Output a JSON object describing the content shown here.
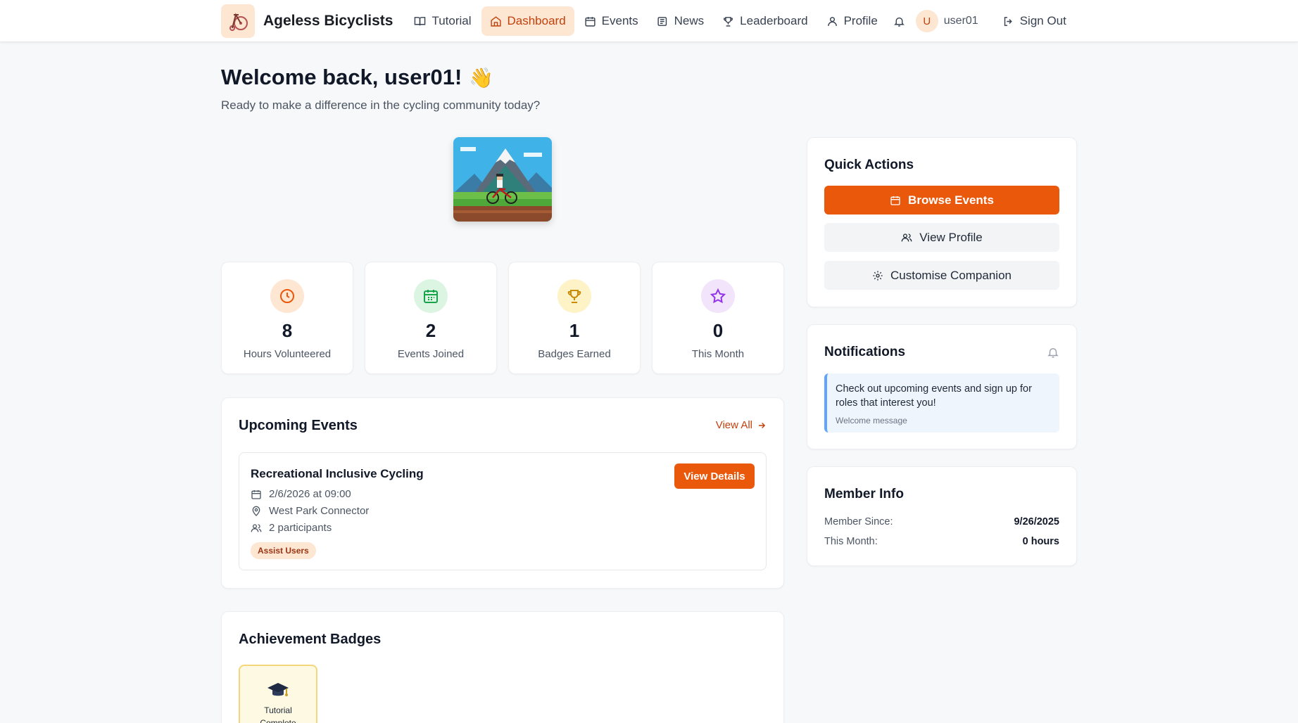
{
  "nav": {
    "brand": "Ageless Bicyclists",
    "items": [
      {
        "label": "Tutorial",
        "icon": "book-icon"
      },
      {
        "label": "Dashboard",
        "icon": "home-icon",
        "active": true
      },
      {
        "label": "Events",
        "icon": "calendar-icon"
      },
      {
        "label": "News",
        "icon": "newspaper-icon"
      },
      {
        "label": "Leaderboard",
        "icon": "trophy-icon"
      },
      {
        "label": "Profile",
        "icon": "user-icon"
      }
    ],
    "avatar_initial": "U",
    "username": "user01",
    "sign_out": "Sign Out"
  },
  "header": {
    "welcome": "Welcome back, user01!",
    "wave": "👋",
    "subtitle": "Ready to make a difference in the cycling community today?"
  },
  "stats": [
    {
      "value": "8",
      "label": "Hours Volunteered",
      "icon": "clock-icon",
      "color": "#ea580c",
      "bg": "#fde6d2"
    },
    {
      "value": "2",
      "label": "Events Joined",
      "icon": "calendar-icon",
      "color": "#16a34a",
      "bg": "#dcf5e3"
    },
    {
      "value": "1",
      "label": "Badges Earned",
      "icon": "trophy-icon",
      "color": "#ca8a04",
      "bg": "#fdf3c7"
    },
    {
      "value": "0",
      "label": "This Month",
      "icon": "star-icon",
      "color": "#9333ea",
      "bg": "#f1e4fb"
    }
  ],
  "upcoming": {
    "title": "Upcoming Events",
    "view_all": "View All",
    "event": {
      "title": "Recreational Inclusive Cycling",
      "datetime": "2/6/2026 at 09:00",
      "location": "West Park Connector",
      "participants": "2 participants",
      "role": "Assist Users",
      "details_button": "View Details"
    }
  },
  "badges": {
    "title": "Achievement Badges",
    "items": [
      {
        "name": "Tutorial Complete",
        "icon": "graduation-cap-icon"
      }
    ]
  },
  "quick_actions": {
    "title": "Quick Actions",
    "browse": "Browse Events",
    "profile": "View Profile",
    "customise": "Customise Companion"
  },
  "notifications": {
    "title": "Notifications",
    "message": "Check out upcoming events and sign up for roles that interest you!",
    "sub": "Welcome message"
  },
  "member_info": {
    "title": "Member Info",
    "since_label": "Member Since:",
    "since_value": "9/26/2025",
    "month_label": "This Month:",
    "month_value": "0 hours"
  },
  "colors": {
    "accent": "#ea580c",
    "accent_soft": "#fde6d2",
    "background": "#f7f8f9"
  }
}
